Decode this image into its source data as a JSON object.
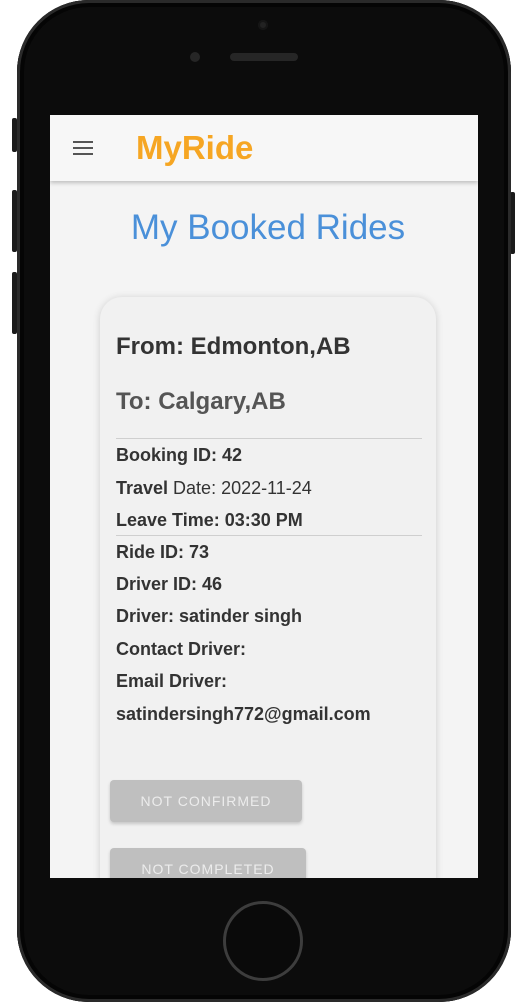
{
  "app": {
    "brand": "MyRide",
    "page_title": "My Booked Rides",
    "colors": {
      "brand": "#f6a623",
      "title": "#4a90d9",
      "button_disabled": "#bfbfbf"
    }
  },
  "toolbar": {
    "menu_icon": "hamburger-menu-icon"
  },
  "booking": {
    "from": "From: Edmonton,AB",
    "to": "To: Calgary,AB",
    "booking_id": "Booking ID: 42",
    "travel_date_label": "Travel",
    "travel_date_value": " Date: 2022-11-24",
    "leave_time": "Leave Time: 03:30 PM",
    "ride_id": "Ride ID: 73",
    "driver_id": "Driver ID: 46",
    "driver": "Driver: satinder singh",
    "contact_driver": "Contact Driver:",
    "email_driver": "Email Driver:",
    "email": "satindersingh772@gmail.com"
  },
  "buttons": {
    "not_confirmed": "NOT CONFIRMED",
    "not_completed": "NOT COMPLETED"
  }
}
